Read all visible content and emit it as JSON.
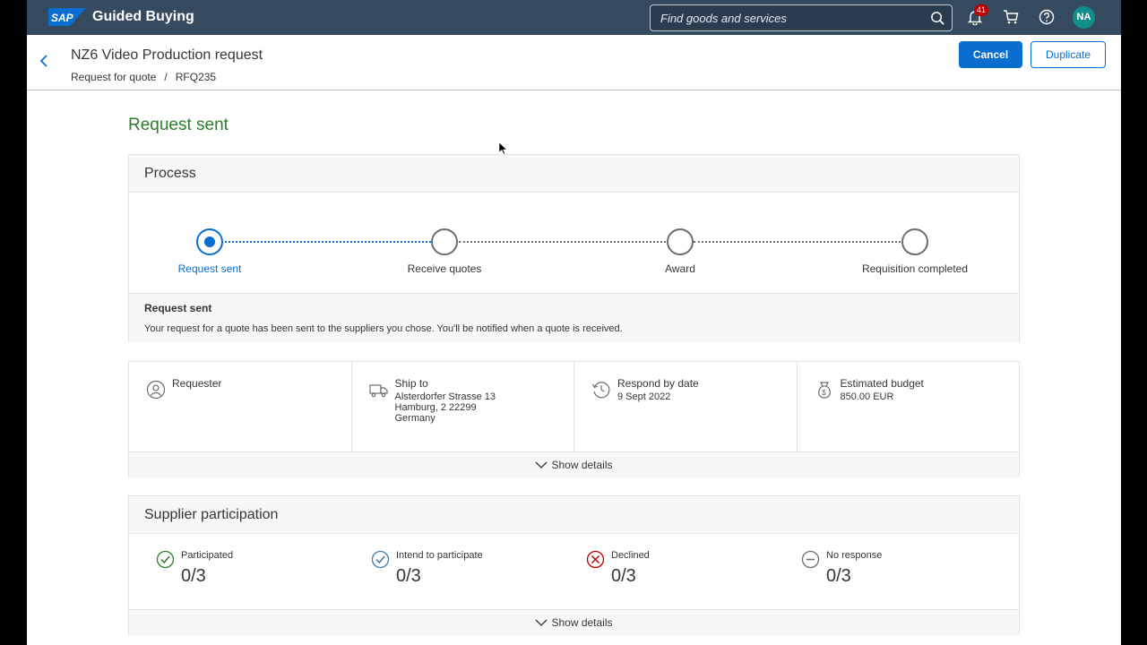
{
  "shell": {
    "brand_logo": "SAP",
    "brand_name": "Guided Buying",
    "search_placeholder": "Find goods and services",
    "notification_count": "41",
    "user_initials": "NA"
  },
  "header": {
    "title": "NZ6 Video Production request",
    "breadcrumb": [
      "Request for quote",
      "/",
      "RFQ235"
    ],
    "cancel_label": "Cancel",
    "duplicate_label": "Duplicate"
  },
  "status_title": "Request sent",
  "process": {
    "title": "Process",
    "steps": [
      "Request sent",
      "Receive quotes",
      "Award",
      "Requisition completed"
    ],
    "active_step": 0,
    "message_title": "Request sent",
    "message_text": "Your request for a quote has been sent to the suppliers you chose. You'll be notified when a quote is received."
  },
  "info": {
    "requester_label": "Requester",
    "ship_to_label": "Ship to",
    "ship_to_lines": [
      "Alsterdorfer Strasse 13",
      "Hamburg, 2 22299",
      "Germany"
    ],
    "respond_label": "Respond by date",
    "respond_value": "9 Sept 2022",
    "budget_label": "Estimated budget",
    "budget_value": "850.00 EUR",
    "show_details": "Show details"
  },
  "suppliers": {
    "title": "Supplier participation",
    "items": [
      {
        "label": "Participated",
        "value": "0/3"
      },
      {
        "label": "Intend to participate",
        "value": "0/3"
      },
      {
        "label": "Declined",
        "value": "0/3"
      },
      {
        "label": "No response",
        "value": "0/3"
      }
    ],
    "show_details": "Show details"
  },
  "colors": {
    "shell_bg": "#354a5f",
    "accent": "#0a6ed1",
    "success": "#2b7d2b",
    "error": "#bb0000"
  }
}
